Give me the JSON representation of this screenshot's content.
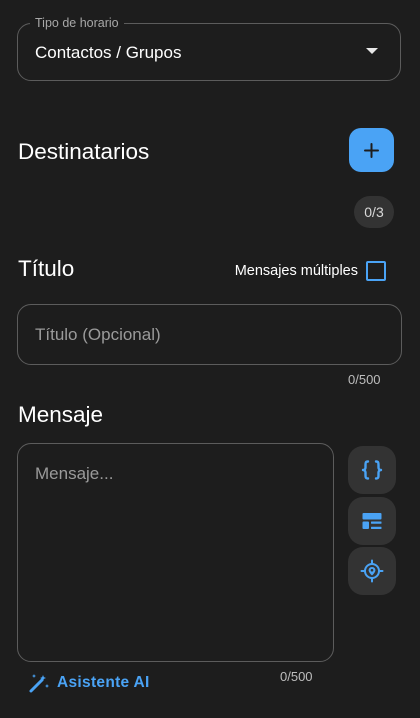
{
  "schedule_type": {
    "label": "Tipo de horario",
    "value": "Contactos / Grupos"
  },
  "recipients": {
    "title": "Destinatarios",
    "count": "0/3"
  },
  "title_section": {
    "title": "Título",
    "multiple_messages_label": "Mensajes múltiples",
    "multiple_messages_checked": false,
    "input_placeholder": "Título (Opcional)",
    "input_value": "",
    "counter": "0/500"
  },
  "message_section": {
    "title": "Mensaje",
    "input_placeholder": "Mensaje...",
    "input_value": "",
    "counter": "0/500",
    "ai_assistant_label": "Asistente AI"
  },
  "icons": {
    "add": "plus-icon",
    "variables": "curly-braces-icon",
    "templates": "template-icon",
    "location": "location-target-icon",
    "ai": "magic-wand-icon"
  },
  "colors": {
    "background": "#1d1d1d",
    "accent": "#4aa3f5",
    "surface": "#333333",
    "border": "#5c5c5c"
  }
}
